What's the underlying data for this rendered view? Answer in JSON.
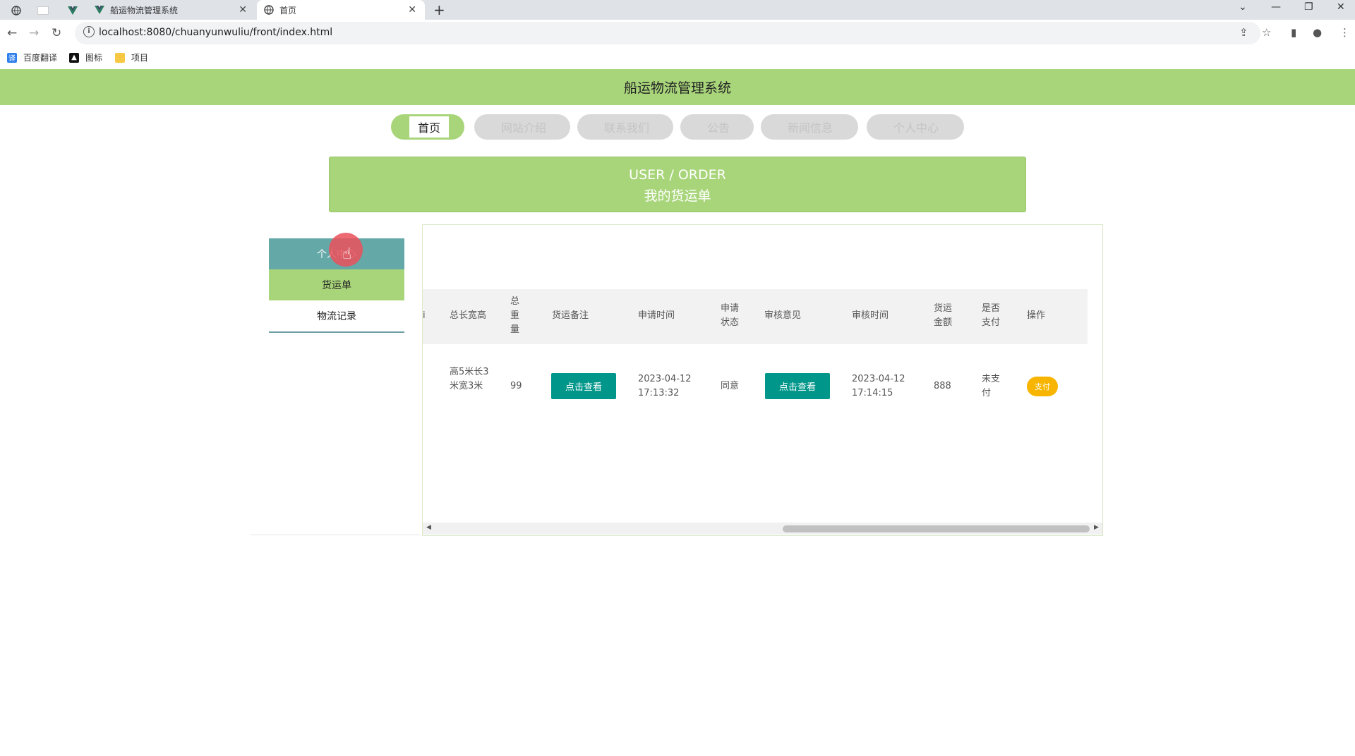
{
  "browser": {
    "tabs": [
      {
        "title": "船运物流管理系统",
        "favicon": "vue-icon",
        "active": false
      },
      {
        "title": "首页",
        "favicon": "globe-icon",
        "active": true
      }
    ],
    "url": "localhost:8080/chuanyunwuliu/front/index.html",
    "bookmarks": [
      {
        "label": "百度翻译",
        "icon": "translate-icon",
        "color": "#2f80ed"
      },
      {
        "label": "图标",
        "icon": "image-icon",
        "color": "#111111"
      },
      {
        "label": "项目",
        "icon": "folder-icon",
        "color": "#f6c844"
      }
    ]
  },
  "site": {
    "title": "船运物流管理系统",
    "nav": [
      {
        "label": "首页",
        "active": true
      },
      {
        "label": "网站介绍",
        "active": false
      },
      {
        "label": "联系我们",
        "active": false
      },
      {
        "label": "公告",
        "active": false
      },
      {
        "label": "新闻信息",
        "active": false
      },
      {
        "label": "个人中心",
        "active": false
      }
    ],
    "banner": {
      "en": "USER / ORDER",
      "cn": "我的货运单"
    },
    "accent": "#a8d57a"
  },
  "sidebar": {
    "items": [
      {
        "label": "个人中心"
      },
      {
        "label": "货运单"
      },
      {
        "label": "物流记录"
      }
    ]
  },
  "table": {
    "headers": {
      "trunc": "i",
      "dimensions": "总长宽高",
      "weight": "总重量",
      "note": "货运备注",
      "apply_time": "申请时间",
      "apply_status": "申请状态",
      "review": "审核意见",
      "review_time": "审核时间",
      "amount": "货运金额",
      "paid": "是否支付",
      "action": "操作"
    },
    "rows": [
      {
        "dimensions": "高5米长3米宽3米",
        "weight": "99",
        "note_btn": "点击查看",
        "apply_time": "2023-04-12 17:13:32",
        "apply_status": "同意",
        "review_btn": "点击查看",
        "review_time": "2023-04-12 17:14:15",
        "amount": "888",
        "paid": "未支付",
        "action": "支付"
      }
    ]
  }
}
